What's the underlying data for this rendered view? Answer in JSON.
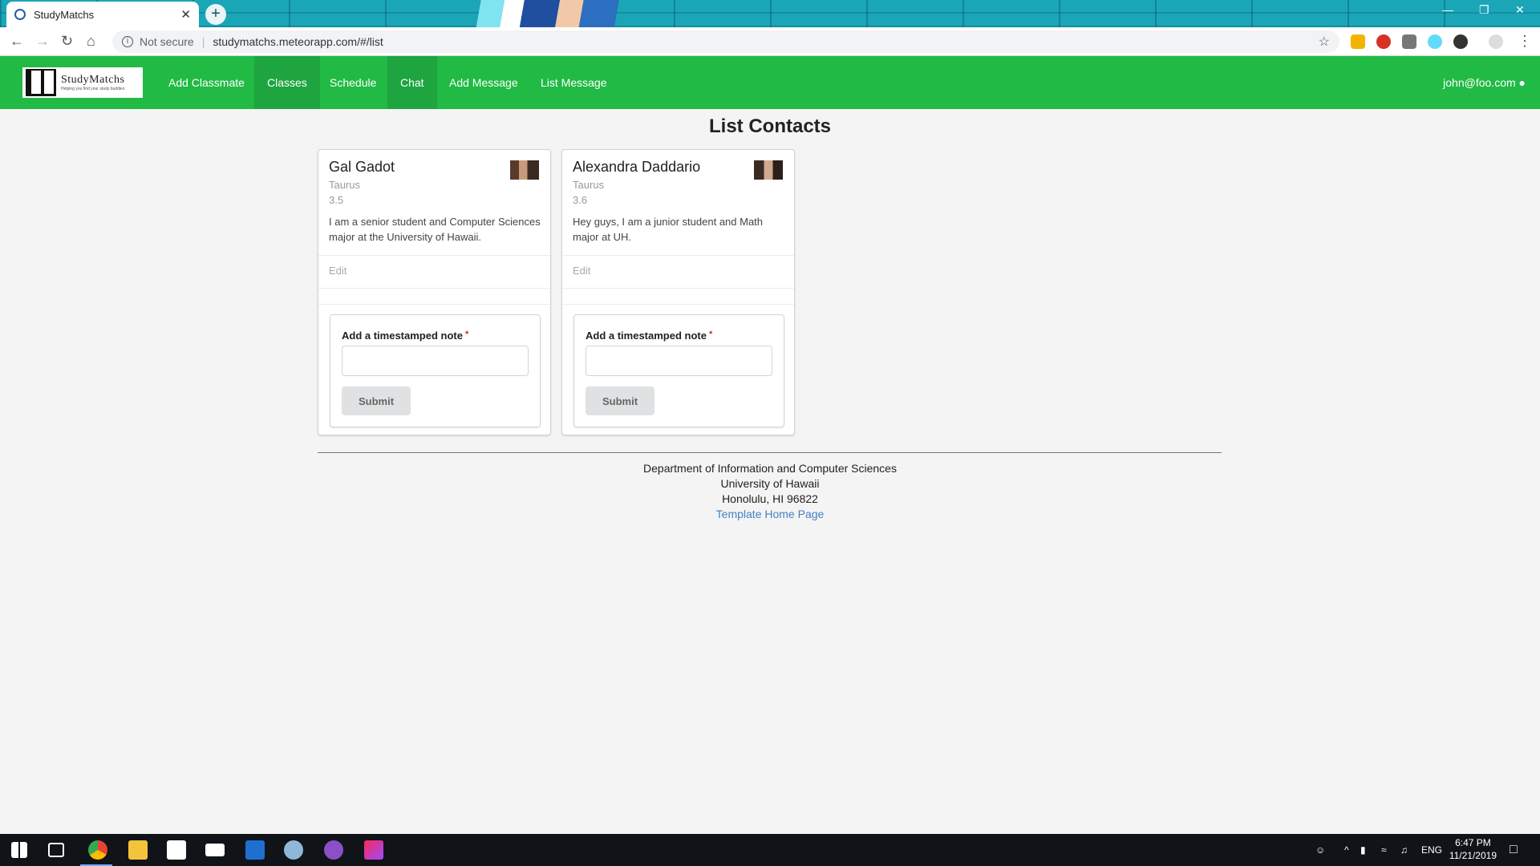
{
  "browser": {
    "tab_title": "StudyMatchs",
    "tab_close": "✕",
    "new_tab": "+",
    "not_secure": "Not secure",
    "url": "studymatchs.meteorapp.com/#/list",
    "controls": {
      "minimize": "—",
      "restore": "❐",
      "close": "✕"
    }
  },
  "navbar": {
    "brand_name": "StudyMatchs",
    "brand_tagline": "Helping you find your study buddies",
    "items": [
      {
        "label": "Add Classmate",
        "active": false
      },
      {
        "label": "Classes",
        "active": true
      },
      {
        "label": "Schedule",
        "active": false
      },
      {
        "label": "Chat",
        "active": true
      },
      {
        "label": "Add Message",
        "active": false
      },
      {
        "label": "List Message",
        "active": false
      }
    ],
    "user_email": "john@foo.com",
    "user_icon": "user-icon"
  },
  "page": {
    "title": "List Contacts"
  },
  "contacts": [
    {
      "name": "Gal Gadot",
      "sign": "Taurus",
      "gpa": "3.5",
      "description": "I am a senior student and Computer Sciences major at the University of Hawaii.",
      "edit_label": "Edit",
      "note_label": "Add a timestamped note",
      "required_mark": "*",
      "note_value": "",
      "submit_label": "Submit"
    },
    {
      "name": "Alexandra Daddario",
      "sign": "Taurus",
      "gpa": "3.6",
      "description": "Hey guys, I am a junior student and Math major at UH.",
      "edit_label": "Edit",
      "note_label": "Add a timestamped note",
      "required_mark": "*",
      "note_value": "",
      "submit_label": "Submit"
    }
  ],
  "footer": {
    "line1": "Department of Information and Computer Sciences",
    "line2": "University of Hawaii",
    "line3": "Honolulu, HI 96822",
    "link": "Template Home Page"
  },
  "taskbar": {
    "language": "ENG",
    "time": "6:47 PM",
    "date": "11/21/2019"
  },
  "colors": {
    "navbar": "#21ba45",
    "navbar_active": "#1ea540",
    "link": "#4183c4",
    "required": "#db2828"
  }
}
